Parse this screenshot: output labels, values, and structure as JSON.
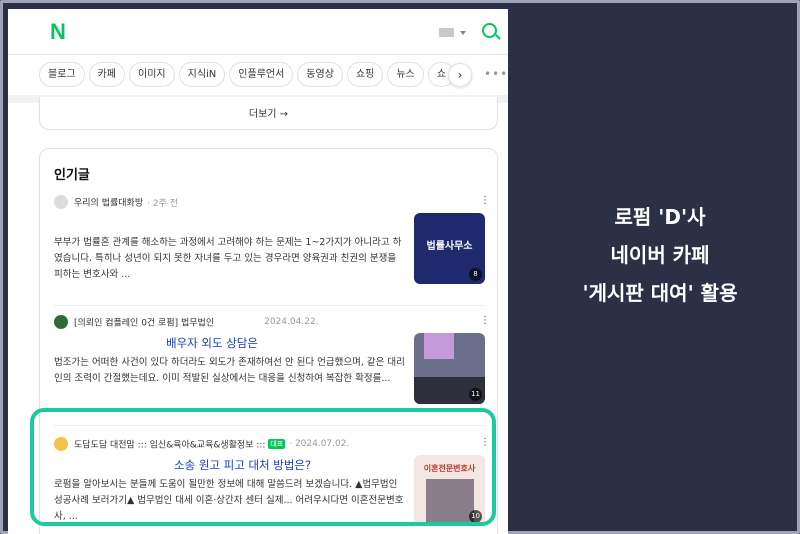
{
  "header": {
    "logo": "N"
  },
  "tabs": [
    "블로그",
    "카페",
    "이미지",
    "지식iN",
    "인플루언서",
    "동영상",
    "쇼핑",
    "뉴스",
    "쇼"
  ],
  "more_link": "더보기 →",
  "section": {
    "title": "인기글"
  },
  "posts": [
    {
      "source": "우리의 법률대화방",
      "date": "· 2주 전",
      "title": "",
      "body": "부부가 법률혼 관계를 해소하는 과정에서 고려해야 하는 문제는 1~2가지가 아니라고 하였습니다. 특히나 성년이 되지 못한 자녀를 두고 있는 경우라면 양육권과 친권의 분쟁을 피하는 변호사와 ...",
      "thumb_text": "법률사무소",
      "thumb_count": "8",
      "thumb_bg": "#1f2a6e"
    },
    {
      "source": "[의뢰인 컴플레인 0건 로펌] 법무법인",
      "date": "2024.04.22.",
      "title": "배우자 외도 상담은",
      "body": "법조가는 어떠한 사건이 있다 하더라도 외도가 존재하여선 안 된다 언급했으며, 같은 대리인의 조력이 간절했는데요. 이미 적발된 실상에서는 대응을 신청하여 복잡한 확정를...",
      "thumb_text": "",
      "thumb_count": "11",
      "thumb_bg": "#6b6f8a"
    },
    {
      "source": "도담도담 대전맘 ::: 임신&육아&교육&생활정보 :::",
      "badge": "대표",
      "date": "· 2024.07.02.",
      "title": "소송 원고 피고 대처 방법은?",
      "body": "로펌을 알아보시는 분들께 도움이 될만한 정보에 대해 말씀드려 보겠습니다. ▲법무법인 성공사례 보러가기▲ 법무법인 대세 이혼·상간자 센터 실제... 어려우시다면 이혼전문변호사, ...",
      "thumb_text": "이혼전문변호사",
      "thumb_count": "10",
      "thumb_bg": "#f4e7e3"
    }
  ],
  "side_caption": [
    "로펌 'D'사",
    "네이버 카페",
    "'게시판 대여' 활용"
  ],
  "colors": {
    "accent": "#03c75a",
    "link": "#1a3dbd",
    "highlight": "#1dc9a0",
    "background": "#2b3047"
  }
}
